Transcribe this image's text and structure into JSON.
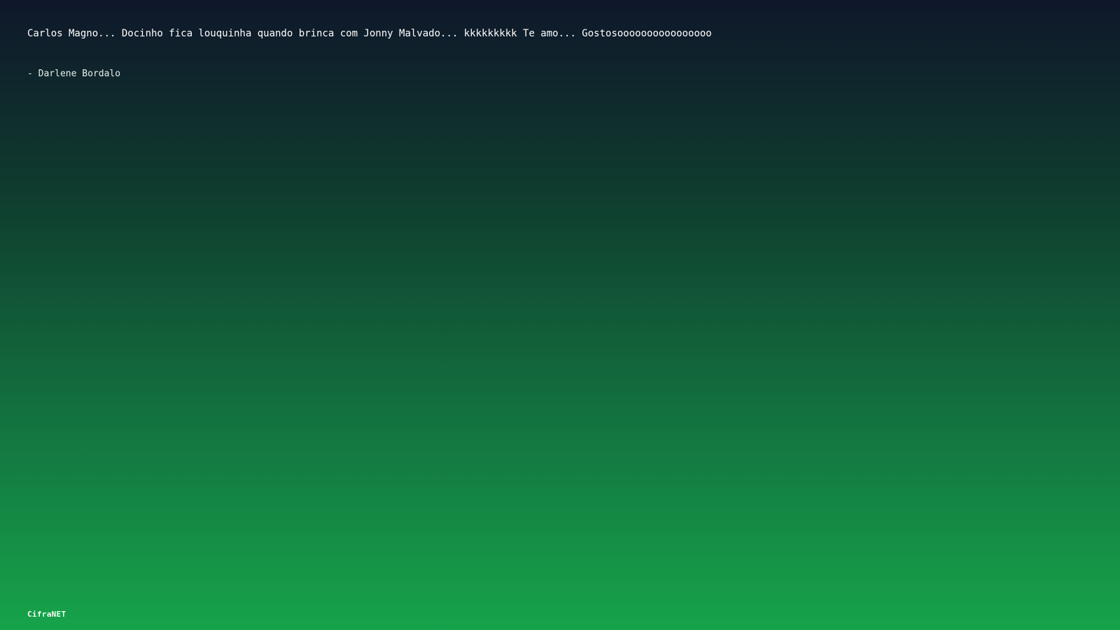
{
  "quote": {
    "text": "Carlos Magno... Docinho fica louquinha quando brinca com Jonny Malvado... kkkkkkkkk Te amo... Gostosoooooooooooooooo",
    "author": "- Darlene Bordalo"
  },
  "footer": {
    "brand": "CifraNET"
  },
  "colors": {
    "gradient_top": "#0f172a",
    "gradient_bottom": "#16a34a",
    "text": "#ffffff"
  }
}
